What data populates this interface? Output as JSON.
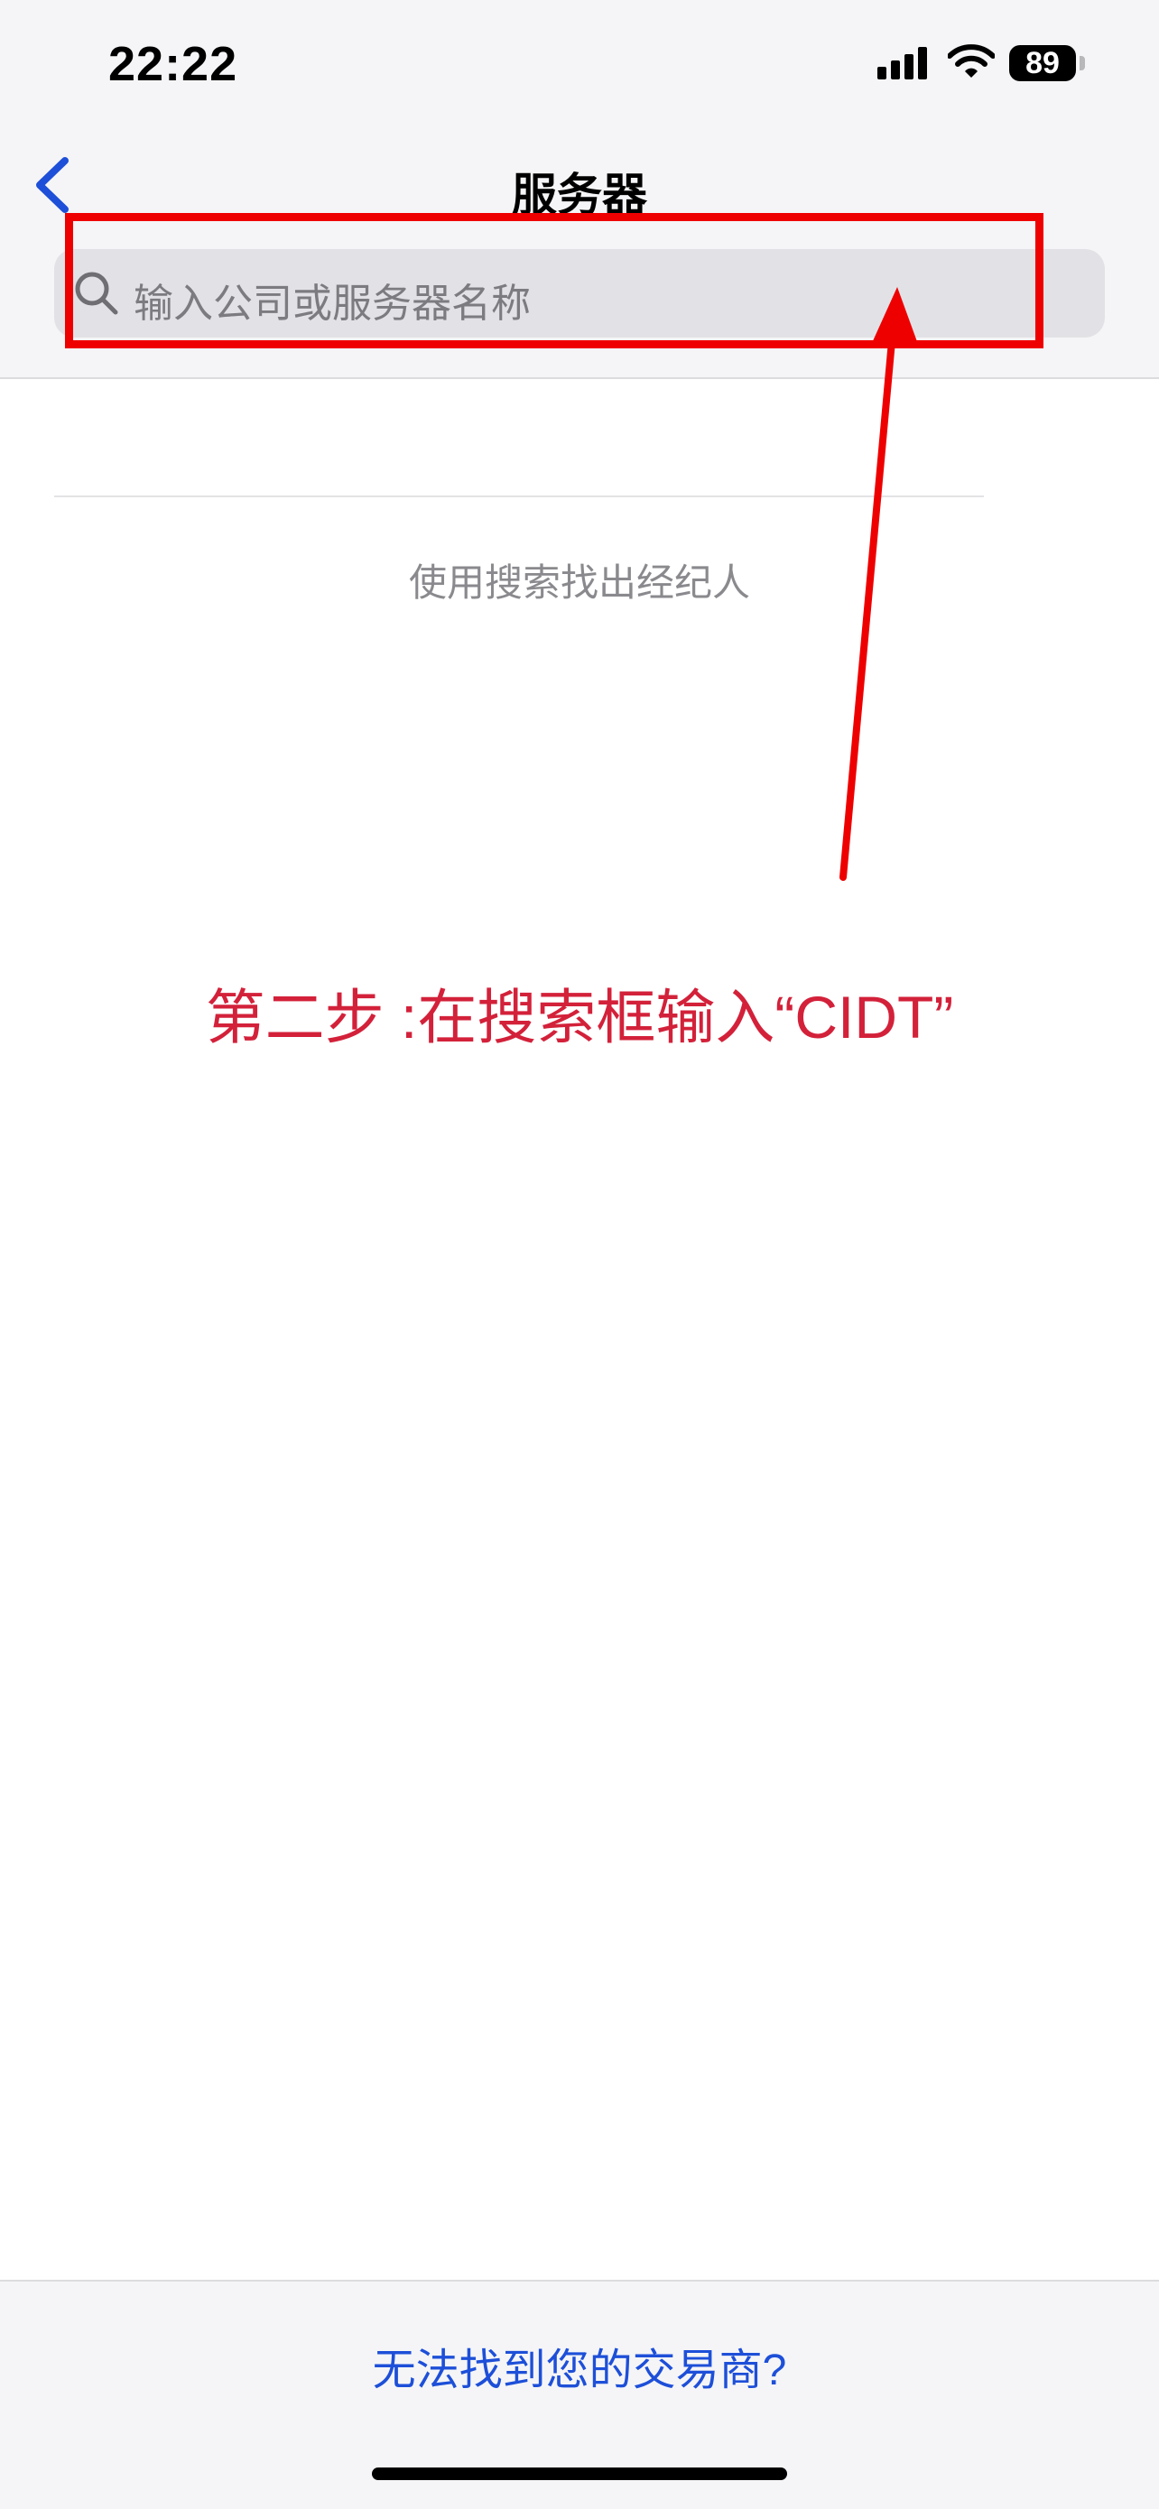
{
  "status_bar": {
    "time": "22:22",
    "battery": "89"
  },
  "nav": {
    "title": "服务器"
  },
  "search": {
    "placeholder": "输入公司或服务器名称"
  },
  "hint": "使用搜索找出经纪人",
  "annotation": {
    "instruction": "第二步 :在搜索框输入“CIDT”",
    "color": "#d3213a",
    "box_color": "#ee0000"
  },
  "footer": {
    "link": "无法找到您的交易商?"
  },
  "colors": {
    "accent": "#1d4fd8",
    "background": "#ffffff",
    "bar_background": "#f5f5f7"
  },
  "icons": [
    "signal-icon",
    "wifi-icon",
    "back-chevron-icon",
    "search-icon"
  ]
}
